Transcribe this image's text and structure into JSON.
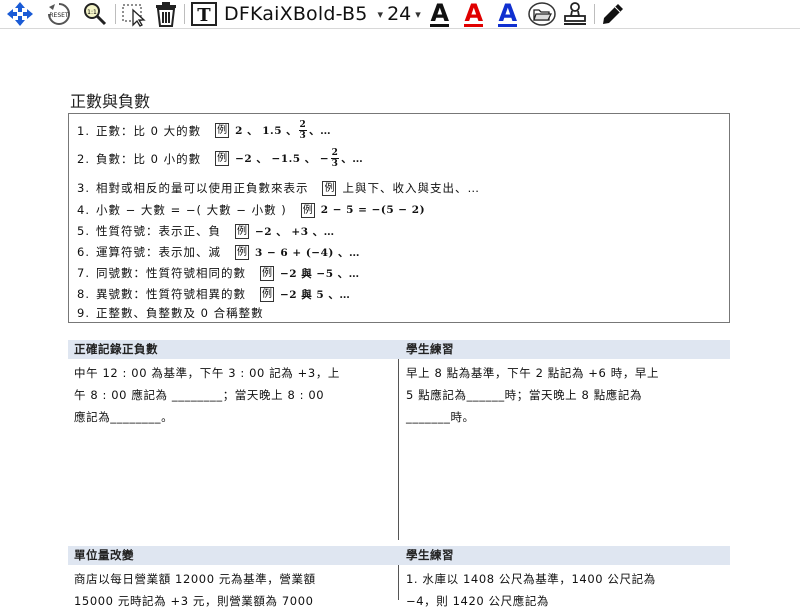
{
  "toolbar": {
    "icons": [
      "move-icon",
      "reset-icon",
      "zoom-icon",
      "select-icon",
      "trash-icon",
      "text-tool-icon",
      "underline-a-black-icon",
      "underline-a-red-icon",
      "underline-a-blue-icon",
      "open-folder-icon",
      "stamp-icon",
      "pen-icon"
    ],
    "reset_label": "RESET",
    "text_tool_label": "T",
    "font_name": "DFKaiXBold-B5",
    "font_size": "24",
    "color_a_label": "A",
    "colors": {
      "black": "#111111",
      "red": "#e00000",
      "blue": "#1030d0"
    }
  },
  "document": {
    "title": "正數與負數",
    "definitions": [
      {
        "n": "1.",
        "text": "正數：比 0 大的數",
        "example": "2 、 1.5 、",
        "frac_num": "2",
        "frac_den": "3",
        "tail": "、…",
        "prefix": ""
      },
      {
        "n": "2.",
        "text": "負數：比 0 小的數",
        "example": "−2 、 −1.5 、 −",
        "frac_num": "2",
        "frac_den": "3",
        "tail": "、…",
        "prefix": ""
      },
      {
        "n": "3.",
        "text": "相對或相反的量可以使用正負數來表示",
        "example": "上與下、收入與支出、…"
      },
      {
        "n": "4.",
        "text": "小數 − 大數 = −( 大數 − 小數 )",
        "example": "2 − 5 = −(5 − 2)"
      },
      {
        "n": "5.",
        "text": "性質符號：表示正、負",
        "example": "−2 、 +3 、…"
      },
      {
        "n": "6.",
        "text": "運算符號：表示加、減",
        "example": "3 − 6 + (−4) 、…"
      },
      {
        "n": "7.",
        "text": "同號數：性質符號相同的數",
        "example": "−2 與 −5 、…"
      },
      {
        "n": "8.",
        "text": "異號數：性質符號相異的數",
        "example": "−2 與 5 、…"
      },
      {
        "n": "9.",
        "text": "正整數、負整數及 0 合稱整數"
      }
    ],
    "example_mark": "例",
    "panels": [
      {
        "head": "正確記錄正負數",
        "lines": [
          "中午 12 : 00 為基準，下午 3 : 00 記為 +3，上",
          "午 8 : 00 應記為 ________；當天晚上 8 : 00",
          "應記為________。"
        ]
      },
      {
        "head": "學生練習",
        "lines": [
          "早上 8 點為基準，下午 2 點記為 +6 時，早上",
          "5 點應記為______時；當天晚上 8 點應記為",
          "_______時。"
        ]
      },
      {
        "head": "單位量改變",
        "lines": [
          "商店以每日營業額 12000 元為基準，營業額",
          "15000 元時記為 +3 元，則營業額為 7000"
        ]
      },
      {
        "head": "學生練習",
        "lines": [
          "1. 水庫以 1408 公尺為基準，1400 公尺記為",
          "−4，則 1420 公尺應記為"
        ]
      }
    ]
  }
}
